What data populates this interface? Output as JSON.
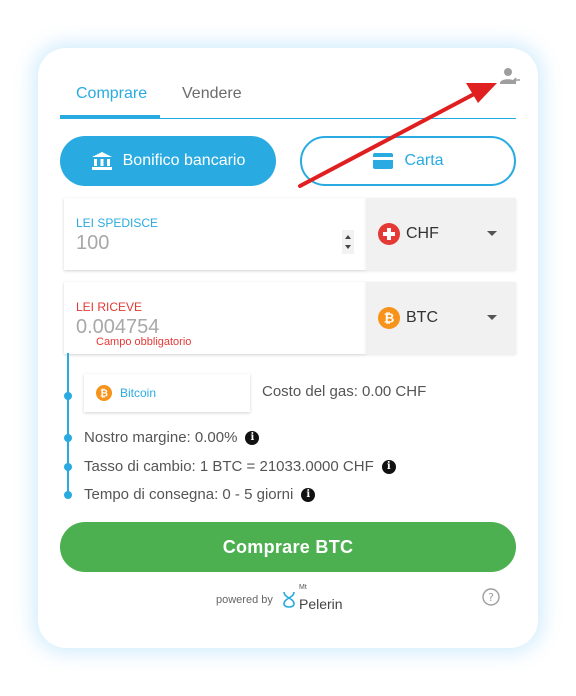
{
  "tabs": {
    "buy": "Comprare",
    "sell": "Vendere"
  },
  "payment": {
    "bank": "Bonifico bancario",
    "card": "Carta"
  },
  "send": {
    "label": "LEI SPEDISCE",
    "value": "100",
    "currency": "CHF"
  },
  "receive": {
    "label": "LEI RICEVE",
    "value": "0.004754",
    "error": "Campo obbligatorio",
    "currency": "BTC"
  },
  "network": {
    "name": "Bitcoin",
    "gas": "Costo del gas: 0.00 CHF"
  },
  "details": {
    "margin": "Nostro margine: 0.00%",
    "rate": "Tasso di cambio: 1 BTC = 21033.0000 CHF",
    "delivery": "Tempo di consegna: 0 - 5 giorni"
  },
  "cta": "Comprare BTC",
  "footer": {
    "powered": "powered by",
    "brand_top": "Mt",
    "brand": "Pelerin"
  },
  "colors": {
    "accent": "#29abe2",
    "green": "#4caf50",
    "error": "#e53935",
    "btc": "#f7931a",
    "chf": "#e53935",
    "arrow": "#e02020"
  },
  "icons": {
    "account": "user-icon",
    "bank": "bank-icon",
    "card": "credit-card-icon",
    "help": "help-circle-icon"
  }
}
